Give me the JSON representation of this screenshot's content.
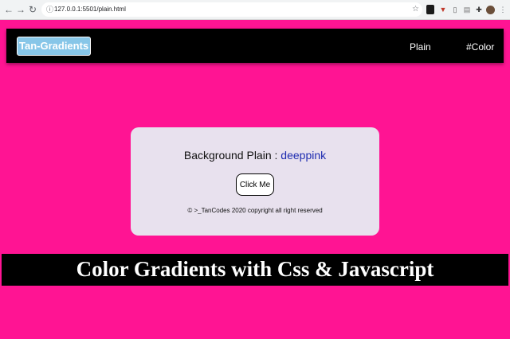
{
  "browser": {
    "url": "127.0.0.1:5501/plain.html",
    "back_icon": "←",
    "forward_icon": "→",
    "reload_icon": "↻",
    "lock_icon": "ⓘ",
    "star_icon": "☆"
  },
  "navbar": {
    "brand": "Tan-Gradients",
    "links": [
      "Plain",
      "#Color"
    ]
  },
  "card": {
    "title_prefix": "Background Plain :",
    "color_value": "deeppink",
    "button_label": "Click Me",
    "copyright": "© >_TanCodes 2020 copyright all right reserved"
  },
  "banner": {
    "text": "Color Gradients with Css & Javascript"
  },
  "colors": {
    "background": "#ff1493",
    "brand_bg": "#87c6e8",
    "card_bg": "#e8e1ee",
    "value_text": "#1d2bb0"
  }
}
